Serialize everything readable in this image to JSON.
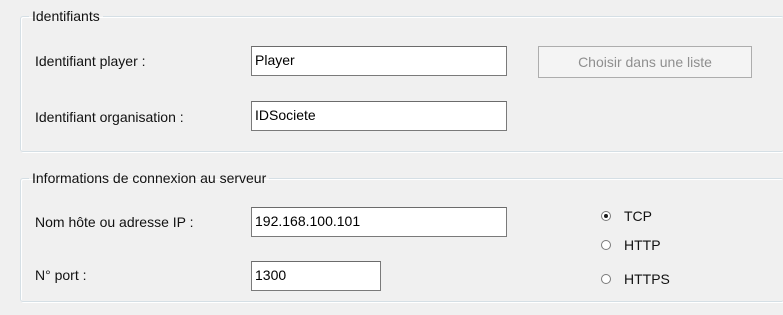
{
  "identifiants": {
    "legend": "Identifiants",
    "player_label": "Identifiant player :",
    "player_value": "Player",
    "choose_button": "Choisir dans une liste",
    "org_label": "Identifiant organisation :",
    "org_value": "IDSociete"
  },
  "connexion": {
    "legend": "Informations de connexion au serveur",
    "host_label": "Nom hôte ou adresse IP :",
    "host_value": "192.168.100.101",
    "port_label": "N° port :",
    "port_value": "1300",
    "protocols": [
      {
        "label": "TCP",
        "selected": true
      },
      {
        "label": "HTTP",
        "selected": false
      },
      {
        "label": "HTTPS",
        "selected": false
      }
    ]
  }
}
